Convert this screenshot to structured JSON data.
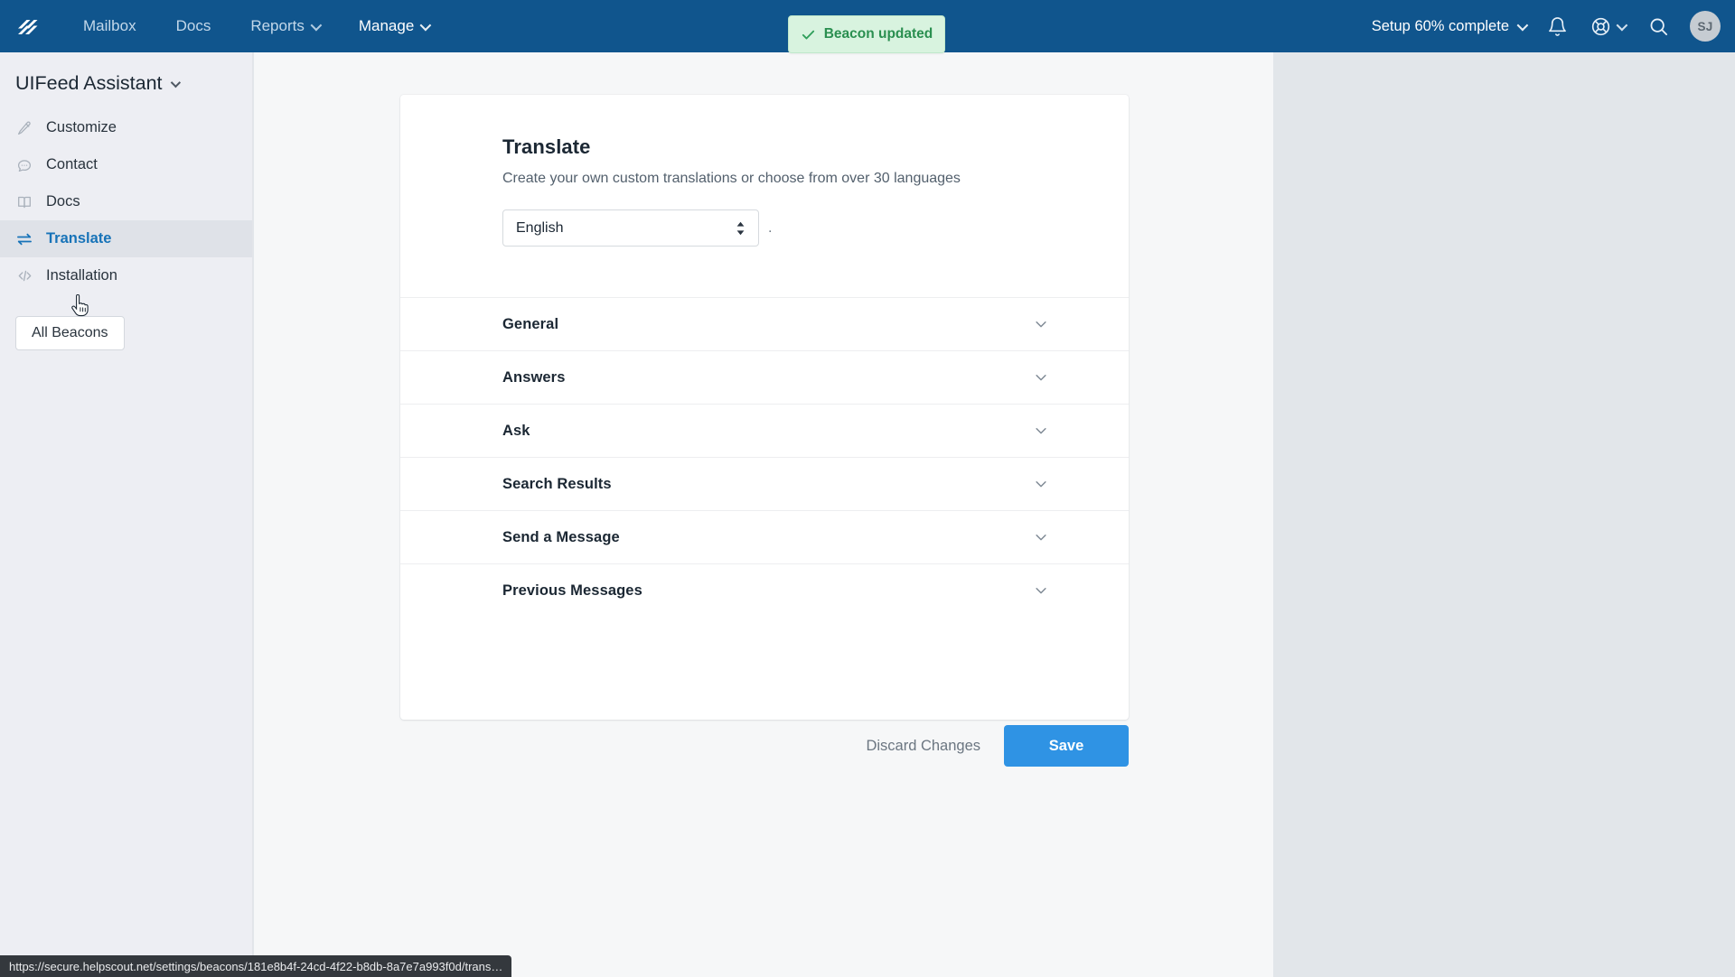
{
  "topnav": {
    "logo_icon": "helpscout-logo-icon",
    "links": [
      {
        "label": "Mailbox",
        "has_chevron": false
      },
      {
        "label": "Docs",
        "has_chevron": false
      },
      {
        "label": "Reports",
        "has_chevron": true
      },
      {
        "label": "Manage",
        "has_chevron": true
      }
    ],
    "setup_label": "Setup 60% complete",
    "setup_progress_percent": 60,
    "bell_icon": "bell-icon",
    "help_icon": "lifebuoy-help-icon",
    "search_icon": "search-icon",
    "avatar_initials": "SJ",
    "background_color": "#10558d"
  },
  "toast": {
    "icon": "check-icon",
    "message": "Beacon updated",
    "text_color": "#2a8f50",
    "background_color": "#d8f3df"
  },
  "sidebar": {
    "beacon_name": "UIFeed Assistant",
    "items": [
      {
        "label": "Customize",
        "icon": "pencil-icon",
        "active": false
      },
      {
        "label": "Contact",
        "icon": "chat-bubble-icon",
        "active": false
      },
      {
        "label": "Docs",
        "icon": "book-icon",
        "active": false
      },
      {
        "label": "Translate",
        "icon": "translate-arrows-icon",
        "active": true
      },
      {
        "label": "Installation",
        "icon": "code-brackets-icon",
        "active": false
      }
    ],
    "all_beacons_label": "All Beacons",
    "active_color": "#1773b8"
  },
  "main": {
    "card": {
      "title": "Translate",
      "subtitle": "Create your own custom translations or choose from over 30 languages",
      "language_select": {
        "value": "English",
        "options": [
          "English"
        ],
        "trailing_text": "."
      },
      "sections": [
        {
          "label": "General",
          "chevron": "chevron-down-icon",
          "expanded": false
        },
        {
          "label": "Answers",
          "chevron": "chevron-down-icon",
          "expanded": false
        },
        {
          "label": "Ask",
          "chevron": "chevron-down-icon",
          "expanded": false
        },
        {
          "label": "Search Results",
          "chevron": "chevron-down-icon",
          "expanded": false
        },
        {
          "label": "Send a Message",
          "chevron": "chevron-down-icon",
          "expanded": false
        },
        {
          "label": "Previous Messages",
          "chevron": "chevron-down-icon",
          "expanded": false
        }
      ]
    },
    "actions": {
      "discard_label": "Discard Changes",
      "save_label": "Save",
      "save_color": "#2f93e4"
    }
  },
  "statusbar": {
    "url": "https://secure.helpscout.net/settings/beacons/181e8b4f-24cd-4f22-b8db-8a7e7a993f0d/trans…"
  }
}
